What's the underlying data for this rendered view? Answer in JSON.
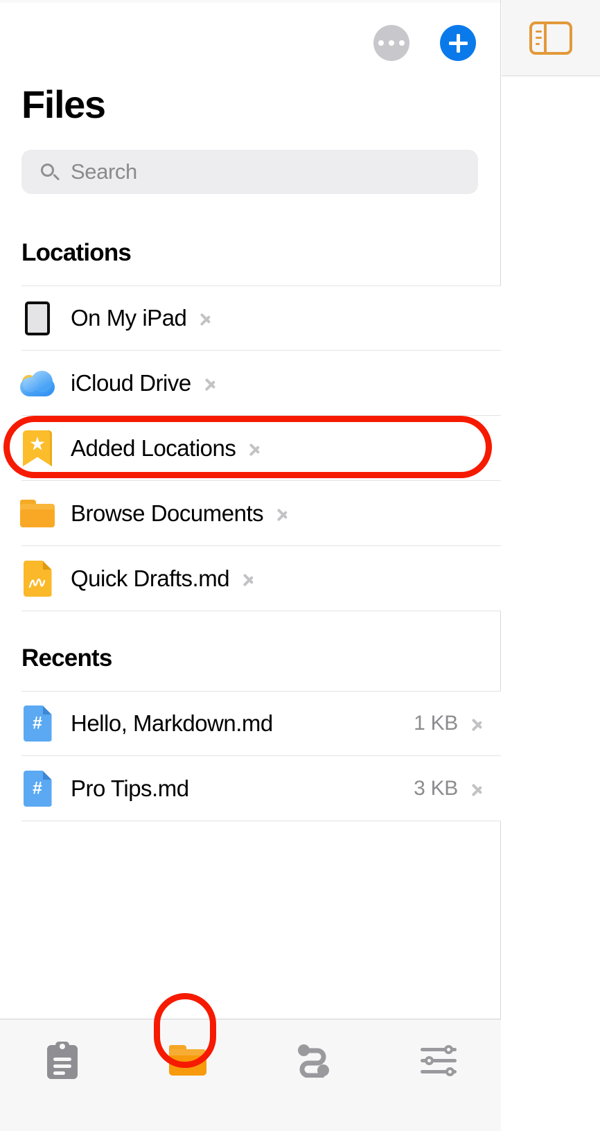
{
  "sidebar": {
    "title": "Files",
    "toolbar": {
      "more_label": "More",
      "more_icon": "ellipsis-circle-icon",
      "add_label": "Add",
      "add_icon": "plus-circle-icon"
    },
    "search": {
      "placeholder": "Search",
      "value": "",
      "icon": "search-icon"
    },
    "sections": [
      {
        "header": "Locations",
        "items": [
          {
            "label": "On My iPad",
            "icon": "ipad-icon",
            "size": "",
            "chevron": "chevron-right-icon"
          },
          {
            "label": "iCloud Drive",
            "icon": "icloud-icon",
            "size": "",
            "chevron": "chevron-right-icon"
          },
          {
            "label": "Added Locations",
            "icon": "bookmark-star-icon",
            "size": "",
            "chevron": "chevron-right-icon",
            "highlighted": true
          },
          {
            "label": "Browse Documents",
            "icon": "folder-icon",
            "size": "",
            "chevron": "chevron-right-icon"
          },
          {
            "label": "Quick Drafts.md",
            "icon": "markdown-draft-icon",
            "size": "",
            "chevron": "chevron-right-icon"
          }
        ]
      },
      {
        "header": "Recents",
        "items": [
          {
            "label": "Hello, Markdown.md",
            "icon": "markdown-file-icon",
            "size": "1 KB",
            "chevron": "chevron-right-icon"
          },
          {
            "label": "Pro Tips.md",
            "icon": "markdown-file-icon",
            "size": "3 KB",
            "chevron": "chevron-right-icon"
          }
        ]
      }
    ]
  },
  "tabbar": {
    "items": [
      {
        "name": "clipboard",
        "icon": "clipboard-icon",
        "active": false
      },
      {
        "name": "files",
        "icon": "folder-icon",
        "active": true
      },
      {
        "name": "flow",
        "icon": "flow-route-icon",
        "active": false
      },
      {
        "name": "settings",
        "icon": "sliders-icon",
        "active": false
      }
    ]
  },
  "right_pane": {
    "toggle_icon": "sidebar-toggle-icon",
    "toggle_label": "Toggle Sidebar"
  },
  "annotations": [
    {
      "target": "Added Locations",
      "shape": "rounded-rect",
      "color": "#f61a00"
    },
    {
      "target": "files-tab",
      "shape": "rounded-rect",
      "color": "#f61a00"
    }
  ],
  "colors": {
    "accent_blue": "#0a7aeb",
    "accent_orange": "#f79a0c",
    "annotation_red": "#f61a00",
    "search_bg": "#ededef",
    "divider": "#e3e3e5",
    "secondary_text": "#8c8c90"
  }
}
